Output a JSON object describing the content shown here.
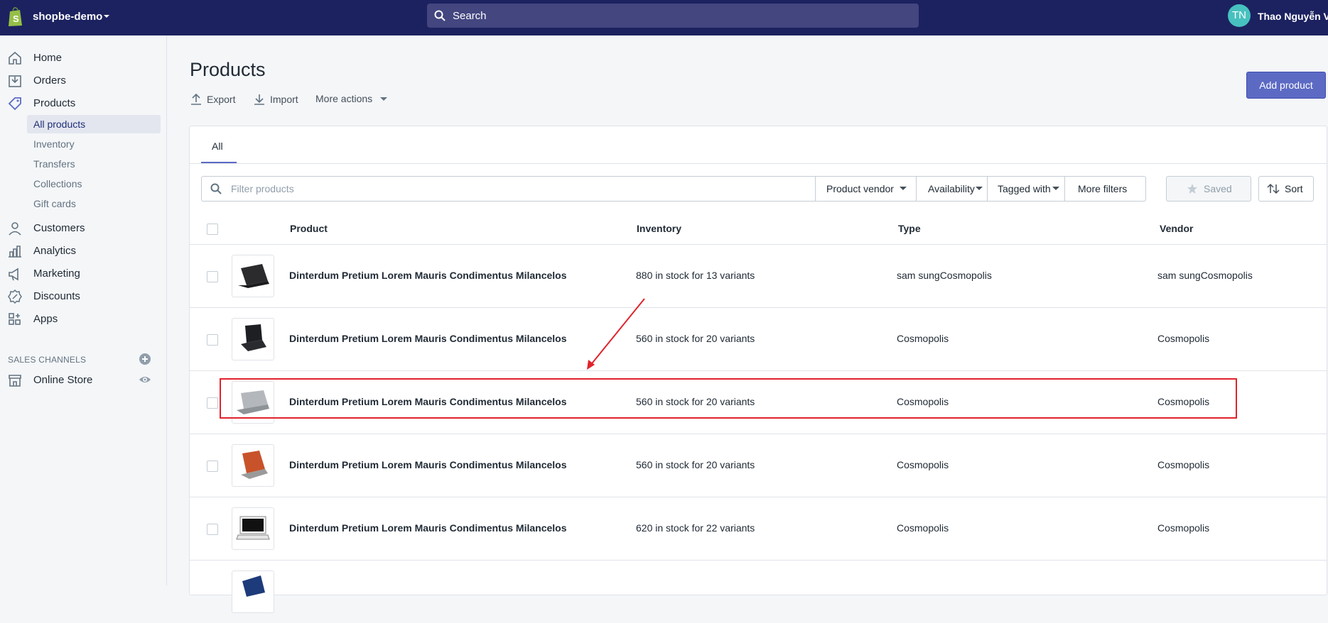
{
  "topbar": {
    "store_name": "shopbe-demo",
    "search_placeholder": "Search",
    "avatar_initials": "TN",
    "user_name": "Thao Nguyễn Vă"
  },
  "sidebar": {
    "items": [
      {
        "label": "Home",
        "icon": "home-icon"
      },
      {
        "label": "Orders",
        "icon": "orders-icon"
      },
      {
        "label": "Products",
        "icon": "tag-icon"
      }
    ],
    "product_sub_items": [
      {
        "label": "All products",
        "selected": true
      },
      {
        "label": "Inventory"
      },
      {
        "label": "Transfers"
      },
      {
        "label": "Collections"
      },
      {
        "label": "Gift cards"
      }
    ],
    "items2": [
      {
        "label": "Customers",
        "icon": "customers-icon"
      },
      {
        "label": "Analytics",
        "icon": "analytics-icon"
      },
      {
        "label": "Marketing",
        "icon": "marketing-icon"
      },
      {
        "label": "Discounts",
        "icon": "discounts-icon"
      },
      {
        "label": "Apps",
        "icon": "apps-icon"
      }
    ],
    "sales_channels_label": "SALES CHANNELS",
    "online_store_label": "Online Store"
  },
  "page": {
    "title": "Products",
    "export_label": "Export",
    "import_label": "Import",
    "more_actions_label": "More actions",
    "add_product_label": "Add product"
  },
  "tabs": [
    {
      "label": "All",
      "selected": true
    }
  ],
  "filters": {
    "placeholder": "Filter products",
    "product_vendor": "Product vendor",
    "availability": "Availability",
    "tagged_with": "Tagged with",
    "more_filters": "More filters",
    "saved": "Saved",
    "sort": "Sort"
  },
  "table": {
    "headers": {
      "product": "Product",
      "inventory": "Inventory",
      "type": "Type",
      "vendor": "Vendor"
    },
    "rows": [
      {
        "name": "Dinterdum Pretium Lorem Mauris Condimentus Milancelos",
        "inventory": "880 in stock for 13 variants",
        "type": "sam sungCosmopolis",
        "vendor": "sam sungCosmopolis",
        "thumb_color": "#2b2b2e"
      },
      {
        "name": "Dinterdum Pretium Lorem Mauris Condimentus Milancelos",
        "inventory": "560 in stock for 20 variants",
        "type": "Cosmopolis",
        "vendor": "Cosmopolis",
        "thumb_color": "#1e1f22"
      },
      {
        "name": "Dinterdum Pretium Lorem Mauris Condimentus Milancelos",
        "inventory": "560 in stock for 20 variants",
        "type": "Cosmopolis",
        "vendor": "Cosmopolis",
        "thumb_color": "#b4b8bd"
      },
      {
        "name": "Dinterdum Pretium Lorem Mauris Condimentus Milancelos",
        "inventory": "560 in stock for 20 variants",
        "type": "Cosmopolis",
        "vendor": "Cosmopolis",
        "thumb_color": "#c8532a"
      },
      {
        "name": "Dinterdum Pretium Lorem Mauris Condimentus Milancelos",
        "inventory": "620 in stock for 22 variants",
        "type": "Cosmopolis",
        "vendor": "Cosmopolis",
        "thumb_color": "#f2f2f2"
      }
    ]
  },
  "colors": {
    "topbar": "#1c2260",
    "primary": "#5c6ac4",
    "annotation": "#e0232b"
  }
}
